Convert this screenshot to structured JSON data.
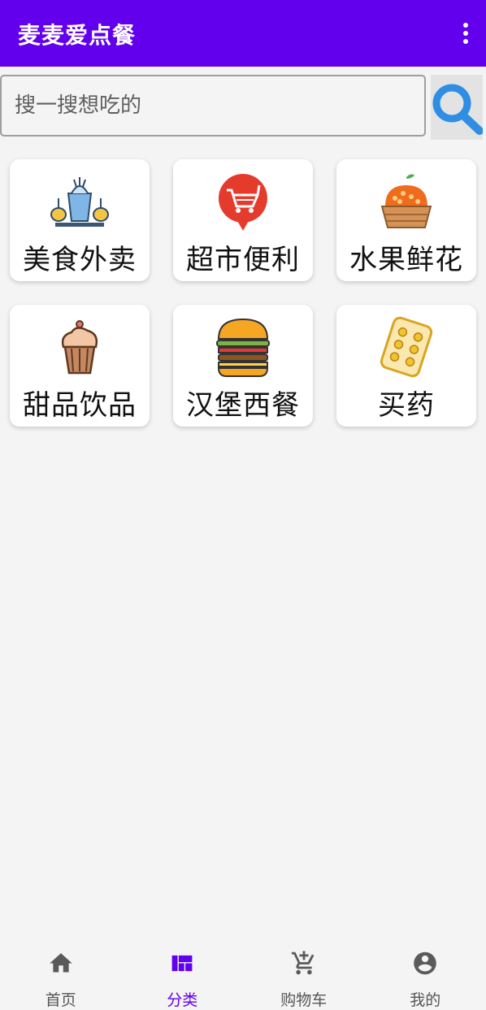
{
  "app": {
    "title": "麦麦爱点餐",
    "accent_color": "#6200ee",
    "overflow_icon": "more-vert-icon"
  },
  "search": {
    "placeholder": "搜一搜想吃的",
    "value": "",
    "button_icon": "search-icon"
  },
  "categories": [
    {
      "label": "美食外卖",
      "icon": "food-delivery-icon"
    },
    {
      "label": "超市便利",
      "icon": "shopping-cart-icon"
    },
    {
      "label": "水果鲜花",
      "icon": "fruit-basket-icon"
    },
    {
      "label": "甜品饮品",
      "icon": "cupcake-icon"
    },
    {
      "label": "汉堡西餐",
      "icon": "burger-icon"
    },
    {
      "label": "买药",
      "icon": "pills-icon"
    }
  ],
  "bottom_nav": {
    "active_index": 1,
    "items": [
      {
        "label": "首页",
        "icon": "home-icon"
      },
      {
        "label": "分类",
        "icon": "category-dashboard-icon"
      },
      {
        "label": "购物车",
        "icon": "add-cart-icon"
      },
      {
        "label": "我的",
        "icon": "account-circle-icon"
      }
    ]
  }
}
